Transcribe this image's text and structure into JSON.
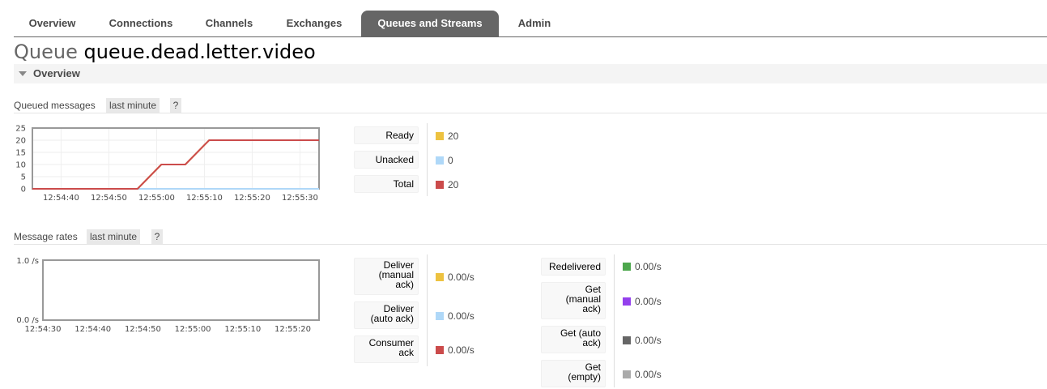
{
  "nav": {
    "tabs": [
      {
        "label": "Overview"
      },
      {
        "label": "Connections"
      },
      {
        "label": "Channels"
      },
      {
        "label": "Exchanges"
      },
      {
        "label": "Queues and Streams",
        "active": true
      },
      {
        "label": "Admin"
      }
    ]
  },
  "page": {
    "kind": "Queue",
    "name": "queue.dead.letter.video"
  },
  "section": {
    "title": "Overview"
  },
  "queued_messages": {
    "label": "Queued messages",
    "range": "last minute",
    "help": "?",
    "legend": [
      {
        "label": "Ready",
        "value": "20",
        "color": "#edc240"
      },
      {
        "label": "Unacked",
        "value": "0",
        "color": "#afd8f8"
      },
      {
        "label": "Total",
        "value": "20",
        "color": "#cb4b4b"
      }
    ]
  },
  "message_rates": {
    "label": "Message rates",
    "range": "last minute",
    "help": "?",
    "legend_left": [
      {
        "label": [
          "Deliver",
          "(manual",
          "ack)"
        ],
        "value": "0.00/s",
        "color": "#edc240"
      },
      {
        "label": [
          "Deliver",
          "(auto ack)"
        ],
        "value": "0.00/s",
        "color": "#afd8f8"
      },
      {
        "label": [
          "Consumer",
          "ack"
        ],
        "value": "0.00/s",
        "color": "#cb4b4b"
      }
    ],
    "legend_right": [
      {
        "label": [
          "Redelivered"
        ],
        "value": "0.00/s",
        "color": "#4da74d"
      },
      {
        "label": [
          "Get",
          "(manual",
          "ack)"
        ],
        "value": "0.00/s",
        "color": "#9440ed"
      },
      {
        "label": [
          "Get (auto",
          "ack)"
        ],
        "value": "0.00/s",
        "color": "#666666"
      },
      {
        "label": [
          "Get",
          "(empty)"
        ],
        "value": "0.00/s",
        "color": "#aaaaaa"
      }
    ]
  },
  "chart_data": [
    {
      "type": "line",
      "x": [
        "12:54:34",
        "12:54:40",
        "12:54:50",
        "12:54:56",
        "12:55:01",
        "12:55:06",
        "12:55:11",
        "12:55:20",
        "12:55:30",
        "12:55:34"
      ],
      "xticks": [
        "12:54:40",
        "12:54:50",
        "12:55:00",
        "12:55:10",
        "12:55:20",
        "12:55:30"
      ],
      "yticks": [
        0,
        5,
        10,
        15,
        20,
        25
      ],
      "ylim": [
        0,
        25
      ],
      "series": [
        {
          "name": "Ready",
          "color": "#edc240",
          "values": [
            0,
            0,
            0,
            0,
            10,
            10,
            20,
            20,
            20,
            20
          ]
        },
        {
          "name": "Unacked",
          "color": "#afd8f8",
          "values": [
            0,
            0,
            0,
            0,
            0,
            0,
            0,
            0,
            0,
            0
          ]
        },
        {
          "name": "Total",
          "color": "#cb4b4b",
          "values": [
            0,
            0,
            0,
            0,
            10,
            10,
            20,
            20,
            20,
            20
          ]
        }
      ],
      "grid": true
    },
    {
      "type": "line",
      "xticks": [
        "12:54:30",
        "12:54:40",
        "12:54:50",
        "12:55:00",
        "12:55:10",
        "12:55:20"
      ],
      "yticks": [
        "0.0 /s",
        "1.0 /s"
      ],
      "ylim": [
        0,
        1
      ],
      "series": [],
      "grid": false
    }
  ]
}
